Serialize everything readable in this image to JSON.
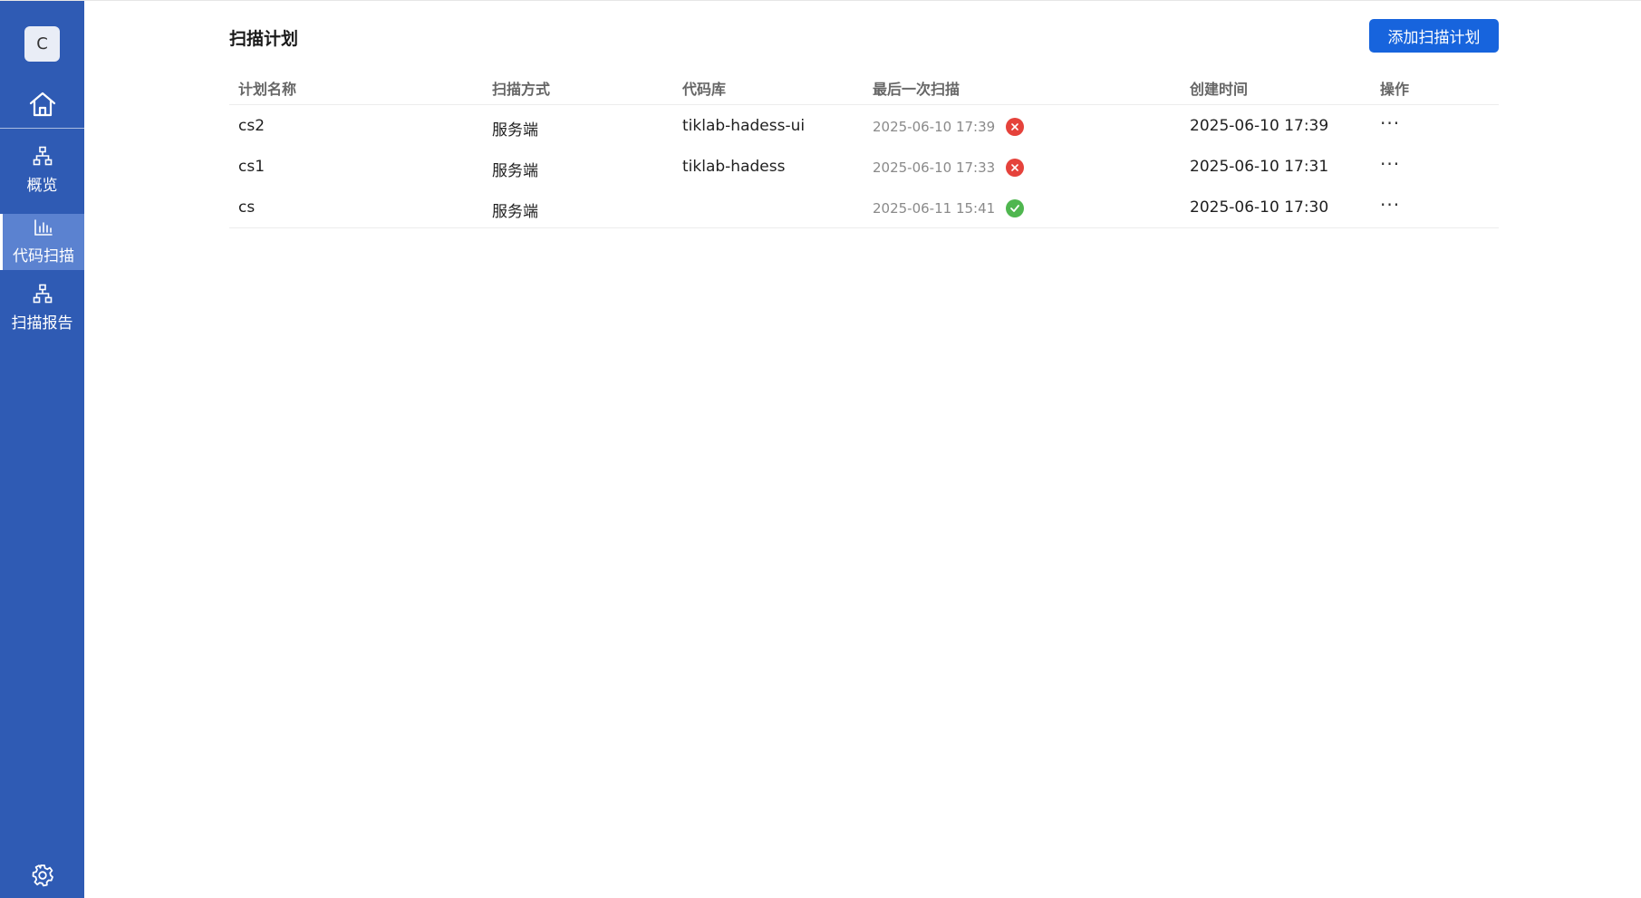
{
  "sidebar": {
    "avatar_letter": "C",
    "items": [
      {
        "label": "概览",
        "icon": "sitemap-icon"
      },
      {
        "label": "代码扫描",
        "icon": "bar-chart-icon"
      },
      {
        "label": "扫描报告",
        "icon": "sitemap-icon"
      }
    ],
    "active_index": 1
  },
  "main": {
    "title": "扫描计划",
    "add_button_label": "添加扫描计划"
  },
  "table": {
    "columns": [
      "计划名称",
      "扫描方式",
      "代码库",
      "最后一次扫描",
      "创建时间",
      "操作"
    ],
    "rows": [
      {
        "name": "cs2",
        "method": "服务端",
        "repo": "tiklab-hadess-ui",
        "last_scan": "2025-06-10 17:39",
        "status": "failed",
        "created": "2025-06-10 17:39",
        "action": "···"
      },
      {
        "name": "cs1",
        "method": "服务端",
        "repo": "tiklab-hadess",
        "last_scan": "2025-06-10 17:33",
        "status": "failed",
        "created": "2025-06-10 17:31",
        "action": "···"
      },
      {
        "name": "cs",
        "method": "服务端",
        "repo": "",
        "last_scan": "2025-06-11 15:41",
        "status": "success",
        "created": "2025-06-10 17:30",
        "action": "···"
      }
    ]
  },
  "colors": {
    "sidebar_bg": "#2f5bb4",
    "sidebar_active": "#5b82d0",
    "primary_button": "#1764dd",
    "status_failed": "#e5423b",
    "status_success": "#4fb64f"
  }
}
